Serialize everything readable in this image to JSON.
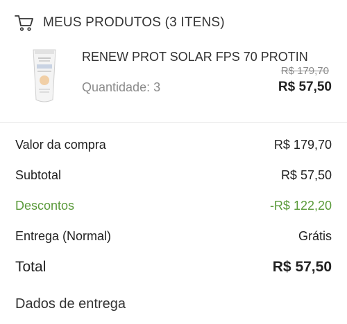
{
  "header": {
    "title": "MEUS PRODUTOS (3 ITENS)",
    "icon": "cart-icon"
  },
  "product": {
    "name": "RENEW PROT SOLAR FPS 70 PROTIN",
    "old_price": "R$ 179,70",
    "price": "R$ 57,50",
    "quantity": "Quantidade: 3",
    "image_icon": "sunscreen-tube-image"
  },
  "summary": [
    {
      "label": "Valor da compra",
      "value": "R$ 179,70"
    },
    {
      "label": "Subtotal",
      "value": "R$ 57,50"
    },
    {
      "label": "Descontos",
      "value": "-R$ 122,20"
    },
    {
      "label": "Entrega (Normal)",
      "value": "Grátis"
    }
  ],
  "total": {
    "label": "Total",
    "value": "R$ 57,50"
  },
  "delivery_section": {
    "title": "Dados de entrega"
  },
  "colors": {
    "discount": "#5a9a3a",
    "text": "#222222",
    "muted": "#8a8a8a"
  }
}
